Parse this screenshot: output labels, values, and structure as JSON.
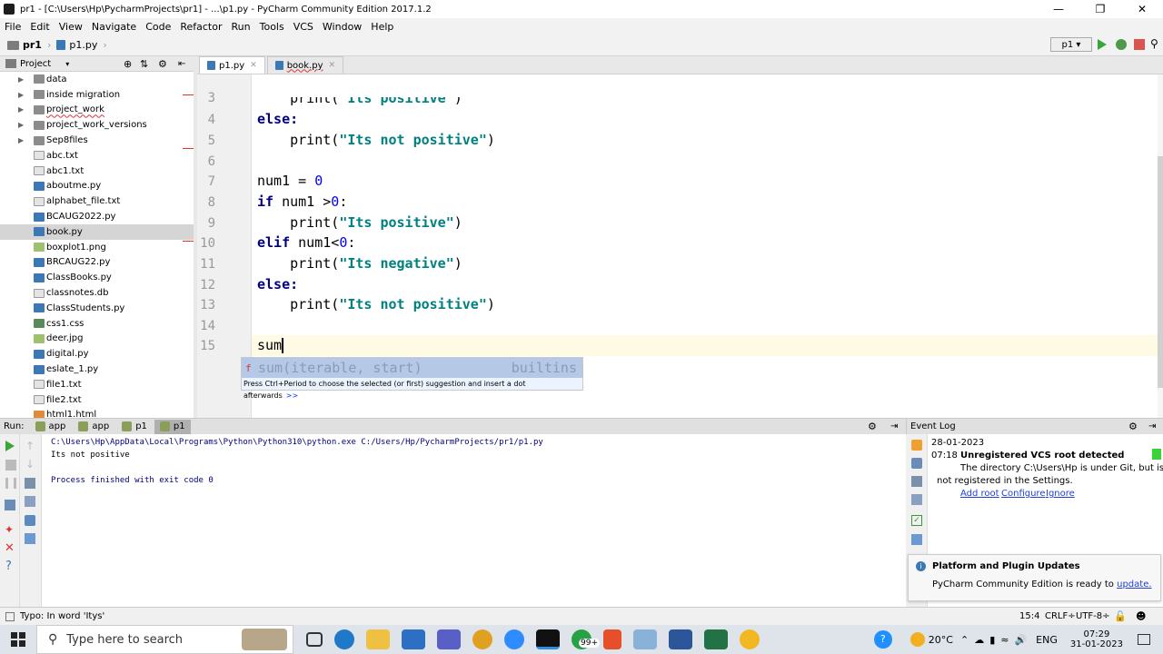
{
  "window": {
    "title": "pr1 - [C:\\Users\\Hp\\PycharmProjects\\pr1] - ...\\p1.py - PyCharm Community Edition 2017.1.2"
  },
  "menu": [
    "File",
    "Edit",
    "View",
    "Navigate",
    "Code",
    "Refactor",
    "Run",
    "Tools",
    "VCS",
    "Window",
    "Help"
  ],
  "breadcrumb": {
    "project": "pr1",
    "file": "p1.py"
  },
  "toolbar": {
    "run_config": "p1"
  },
  "project_panel": {
    "title": "Project",
    "items": [
      {
        "label": "data",
        "type": "folder"
      },
      {
        "label": "inside migration",
        "type": "folder"
      },
      {
        "label": "project_work",
        "type": "folder"
      },
      {
        "label": "project_work_versions",
        "type": "folder"
      },
      {
        "label": "Sep8files",
        "type": "folder"
      },
      {
        "label": "abc.txt",
        "type": "txt"
      },
      {
        "label": "abc1.txt",
        "type": "txt"
      },
      {
        "label": "aboutme.py",
        "type": "py"
      },
      {
        "label": "alphabet_file.txt",
        "type": "txt"
      },
      {
        "label": "BCAUG2022.py",
        "type": "py"
      },
      {
        "label": "book.py",
        "type": "py"
      },
      {
        "label": "boxplot1.png",
        "type": "img"
      },
      {
        "label": "BRCAUG22.py",
        "type": "py"
      },
      {
        "label": "ClassBooks.py",
        "type": "py"
      },
      {
        "label": "classnotes.db",
        "type": "db"
      },
      {
        "label": "ClassStudents.py",
        "type": "py"
      },
      {
        "label": "css1.css",
        "type": "css"
      },
      {
        "label": "deer.jpg",
        "type": "img"
      },
      {
        "label": "digital.py",
        "type": "py"
      },
      {
        "label": "eslate_1.py",
        "type": "py"
      },
      {
        "label": "file1.txt",
        "type": "txt"
      },
      {
        "label": "file2.txt",
        "type": "txt"
      },
      {
        "label": "html1.html",
        "type": "html"
      }
    ]
  },
  "editor_tabs": [
    {
      "label": "p1.py"
    },
    {
      "label": "book.py"
    }
  ],
  "editor": {
    "lines": [
      {
        "n": "3",
        "text": "    print(\"Its positive\")"
      },
      {
        "n": "4",
        "text": "else:"
      },
      {
        "n": "5",
        "text": "    print(\"Its not positive\")"
      },
      {
        "n": "6",
        "text": ""
      },
      {
        "n": "7",
        "text": "num1 = 0"
      },
      {
        "n": "8",
        "text": "if num1 >0:"
      },
      {
        "n": "9",
        "text": "    print(\"Its positive\")"
      },
      {
        "n": "10",
        "text": "elif num1<0:"
      },
      {
        "n": "11",
        "text": "    print(\"Its negative\")"
      },
      {
        "n": "12",
        "text": "else:"
      },
      {
        "n": "13",
        "text": "    print(\"Its not positive\")"
      },
      {
        "n": "14",
        "text": ""
      },
      {
        "n": "15",
        "text": "sum"
      }
    ]
  },
  "autocomplete": {
    "suggestion": "sum(iterable, start)",
    "source": "builtins",
    "hint": "Press Ctrl+Period to choose the selected (or first) suggestion and insert a dot afterwards",
    "hint_link": ">>"
  },
  "run_panel": {
    "label": "Run:",
    "tabs": [
      "app",
      "app",
      "p1",
      "p1"
    ],
    "output": [
      "C:\\Users\\Hp\\AppData\\Local\\Programs\\Python\\Python310\\python.exe C:/Users/Hp/PycharmProjects/pr1/p1.py",
      "Its not positive",
      "",
      "Process finished with exit code 0"
    ]
  },
  "event_log": {
    "title": "Event Log",
    "date": "28-01-2023",
    "time": "07:18",
    "heading": "Unregistered VCS root detected",
    "body1": "The directory C:\\Users\\Hp is under Git, but is",
    "body2": "not registered in the Settings.",
    "links": [
      "Add root",
      "Configure",
      "Ignore"
    ]
  },
  "notification": {
    "title": "Platform and Plugin Updates",
    "text": "PyCharm Community Edition is ready to",
    "link": "update."
  },
  "status": {
    "message": "Typo: In word 'Itys'",
    "position": "15:4",
    "line_sep": "CRLF÷",
    "encoding": "UTF-8÷"
  },
  "taskbar": {
    "search_placeholder": "Type here to search",
    "teams_badge": "99+",
    "weather": "20°C",
    "lang": "ENG",
    "time": "07:29",
    "date": "31-01-2023"
  }
}
